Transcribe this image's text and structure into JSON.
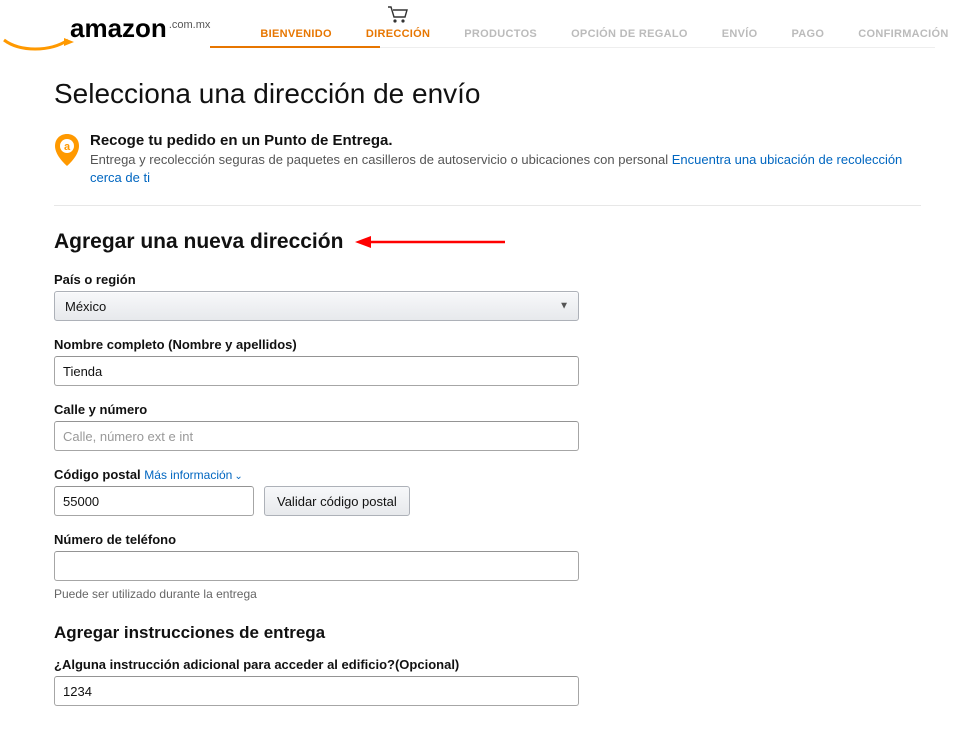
{
  "logo": {
    "main": "amazon",
    "domain": ".com.mx"
  },
  "steps": [
    {
      "label": "BIENVENIDO",
      "state": "done"
    },
    {
      "label": "DIRECCIÓN",
      "state": "active"
    },
    {
      "label": "PRODUCTOS",
      "state": "pending"
    },
    {
      "label": "OPCIÓN DE REGALO",
      "state": "pending"
    },
    {
      "label": "ENVÍO",
      "state": "pending"
    },
    {
      "label": "PAGO",
      "state": "pending"
    },
    {
      "label": "CONFIRMACIÓN",
      "state": "pending"
    }
  ],
  "page_title": "Selecciona una dirección de envío",
  "pickup": {
    "title": "Recoge tu pedido en un Punto de Entrega.",
    "desc": "Entrega y recolección seguras de paquetes en casilleros de autoservicio o ubicaciones con personal ",
    "link": "Encuentra una ubicación de recolección cerca de ti"
  },
  "add_address": {
    "title": "Agregar una nueva dirección",
    "country_label": "País o región",
    "country_value": "México",
    "name_label": "Nombre completo (Nombre y apellidos)",
    "name_value": "Tienda",
    "street_label": "Calle y número",
    "street_placeholder": "Calle, número ext e int",
    "street_value": "",
    "postal_label": "Código postal",
    "postal_more": "Más información",
    "postal_value": "55000",
    "validate_btn": "Validar código postal",
    "phone_label": "Número de teléfono",
    "phone_value": "",
    "phone_hint": "Puede ser utilizado durante la entrega"
  },
  "instructions": {
    "title": "Agregar instrucciones de entrega",
    "question_label": "¿Alguna instrucción adicional para acceder al edificio?(Opcional)",
    "value": "1234"
  }
}
